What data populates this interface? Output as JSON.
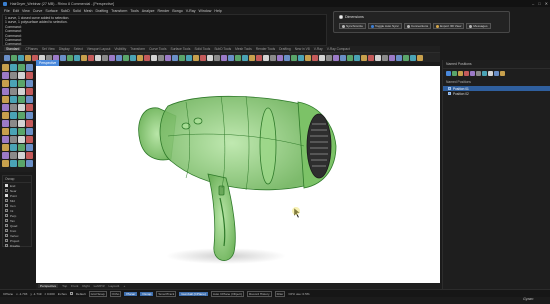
{
  "window": {
    "title": "HairDryer_Webinar (27 MB) - Rhino 8 Commercial - [Perspective]",
    "controls": [
      "–",
      "□",
      "✕"
    ]
  },
  "menu": [
    "File",
    "Edit",
    "View",
    "Curve",
    "Surface",
    "SubD",
    "Solid",
    "Mesh",
    "Drafting",
    "Transform",
    "Tools",
    "Analyze",
    "Render",
    "Bongo",
    "V-Ray",
    "Window",
    "Help"
  ],
  "command_history": [
    "1 curve, 1 closed curve added to selection.",
    "1 curve, 1 polysurface added to selection.",
    "Command:",
    "Command:",
    "Command:",
    "Command:",
    "Command:"
  ],
  "float_panel": {
    "title": "Dimensions",
    "buttons": [
      {
        "label": "Synchronize",
        "color": "#b6b6b6"
      },
      {
        "label": "Toggle Auto Sync",
        "color": "#3b7fd8"
      },
      {
        "label": "Connections",
        "color": "#b6b6b6"
      },
      {
        "label": "Export 3D View",
        "color": "#d7a84a"
      },
      {
        "label": "Messages",
        "color": "#b6b6b6"
      }
    ]
  },
  "toolbar_tabs": [
    "Standard",
    "CPlanes",
    "Set View",
    "Display",
    "Select",
    "Viewport Layout",
    "Visibility",
    "Transform",
    "Curve Tools",
    "Surface Tools",
    "Solid Tools",
    "SubD Tools",
    "Mesh Tools",
    "Render Tools",
    "Drafting",
    "New in V8",
    "V-Ray",
    "V-Ray Compact"
  ],
  "viewport": {
    "label": "Perspective",
    "accent": "#4a89dc",
    "model_color": "#8fd07a",
    "wire_color": "#2f7a2a"
  },
  "viewport_tabs": [
    "Perspective",
    "Top",
    "Front",
    "Right",
    "Left/Prtf",
    "Layout1",
    "+"
  ],
  "right_panel": {
    "title": "Named Positions",
    "section": "Named Positions",
    "items": [
      {
        "label": "Position 01",
        "selected": true
      },
      {
        "label": "Position 02",
        "selected": false
      }
    ]
  },
  "osnap": {
    "title": "Osnap",
    "items": [
      {
        "label": "End",
        "checked": true
      },
      {
        "label": "Near",
        "checked": false
      },
      {
        "label": "Point",
        "checked": true
      },
      {
        "label": "Mid",
        "checked": false
      },
      {
        "label": "Cen",
        "checked": false
      },
      {
        "label": "Int",
        "checked": false
      },
      {
        "label": "Perp",
        "checked": false
      },
      {
        "label": "Tan",
        "checked": false
      },
      {
        "label": "Quad",
        "checked": false
      },
      {
        "label": "Knot",
        "checked": false
      },
      {
        "label": "Vertex",
        "checked": false
      },
      {
        "label": "Project",
        "checked": false
      },
      {
        "label": "Disable",
        "checked": false
      }
    ]
  },
  "status": {
    "cplane": "CPlane",
    "x": "x -1.703",
    "y": "y -1.719",
    "z": "z 0.000",
    "units": "Inches",
    "layer": "Default",
    "toggles": [
      {
        "label": "Grid Snap",
        "active": false
      },
      {
        "label": "Ortho",
        "active": false
      },
      {
        "label": "Planar",
        "active": true
      },
      {
        "label": "Osnap",
        "active": true
      },
      {
        "label": "SmartTrack",
        "active": false
      },
      {
        "label": "Gumball (CPlane)",
        "active": true
      },
      {
        "label": "Auto CPlane (Object)",
        "active": false
      },
      {
        "label": "Record History",
        "active": false
      },
      {
        "label": "Filter",
        "active": false
      }
    ],
    "memory": "CPU use: 0.5%"
  },
  "watermark": "Gyazo"
}
